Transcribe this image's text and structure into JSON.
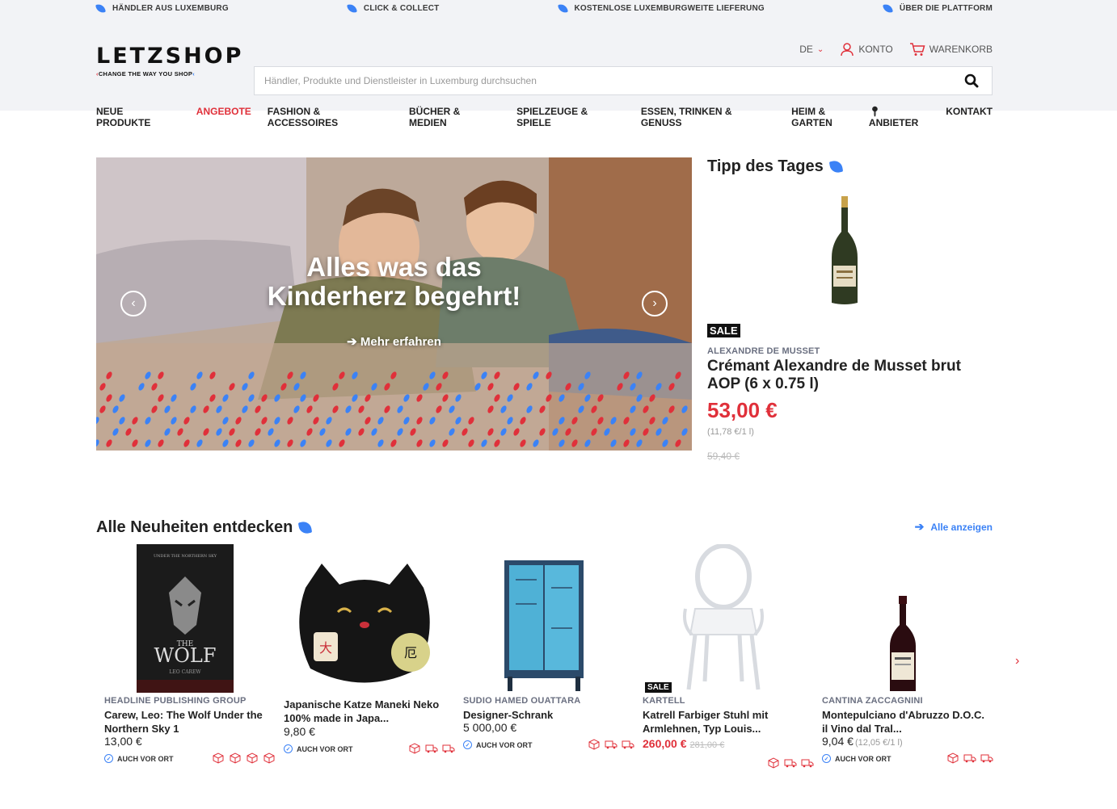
{
  "topbar": {
    "items": [
      "HÄNDLER AUS LUXEMBURG",
      "CLICK & COLLECT",
      "KOSTENLOSE LUXEMBURGWEITE LIEFERUNG",
      "ÜBER DIE PLATTFORM"
    ]
  },
  "header": {
    "logo": "LETZSHOP",
    "tagline": "CHANGE THE WAY YOU SHOP",
    "language": "DE",
    "account_label": "KONTO",
    "cart_label": "WARENKORB",
    "search_placeholder": "Händler, Produkte und Dienstleister in Luxemburg durchsuchen"
  },
  "nav": {
    "left": [
      "NEUE PRODUKTE",
      "ANGEBOTE",
      "FASHION & ACCESSOIRES",
      "BÜCHER & MEDIEN",
      "SPIELZEUGE & SPIELE",
      "ESSEN, TRINKEN & GENUSS",
      "HEIM & GARTEN"
    ],
    "active": "ANGEBOTE",
    "right": [
      "ANBIETER",
      "KONTAKT"
    ]
  },
  "hero": {
    "title_line1": "Alles was das",
    "title_line2": "Kinderherz begehrt!",
    "cta": "Mehr erfahren",
    "prev": "‹",
    "next": "›"
  },
  "tipp": {
    "title": "Tipp des Tages",
    "badge": "SALE",
    "brand": "ALEXANDRE DE MUSSET",
    "name": "Crémant Alexandre de Musset brut AOP (6 x 0.75 l)",
    "price": "53,00 €",
    "unit_price": "(11,78 €/1 l)",
    "old_price": "59,40 €"
  },
  "new_section": {
    "title": "Alle Neuheiten entdecken",
    "all_link": "Alle anzeigen",
    "next": "›"
  },
  "products": [
    {
      "brand": "HEADLINE PUBLISHING GROUP",
      "name": "Carew, Leo: The Wolf Under the Northern Sky 1",
      "price": "13,00 €",
      "local": "AUCH VOR ORT"
    },
    {
      "brand": "",
      "name": "Japanische Katze Maneki Neko 100% made in Japa...",
      "price": "9,80 €",
      "local": "AUCH VOR ORT"
    },
    {
      "brand": "SUDIO HAMED OUATTARA",
      "name": "Designer-Schrank",
      "price": "5 000,00 €",
      "local": "AUCH VOR ORT"
    },
    {
      "brand": "KARTELL",
      "name": "Katrell Farbiger Stuhl mit Armlehnen, Typ Louis...",
      "price": "260,00 €",
      "old_price": "281,00 €",
      "badge": "SALE"
    },
    {
      "brand": "CANTINA ZACCAGNINI",
      "name": "Montepulciano d'Abruzzo D.O.C. il Vino dal Tral...",
      "price": "9,04 €",
      "unit_price": "(12,05 €/1 l)",
      "local": "AUCH VOR ORT"
    }
  ],
  "book_cover": {
    "top": "UNDER THE NORTHERN SKY",
    "title_line1": "THE",
    "title_line2": "WOLF",
    "author": "LEO CAREW"
  },
  "colors": {
    "accent_red": "#e0303a",
    "accent_blue": "#3b82f6",
    "header_bg": "#f2f3f6"
  }
}
